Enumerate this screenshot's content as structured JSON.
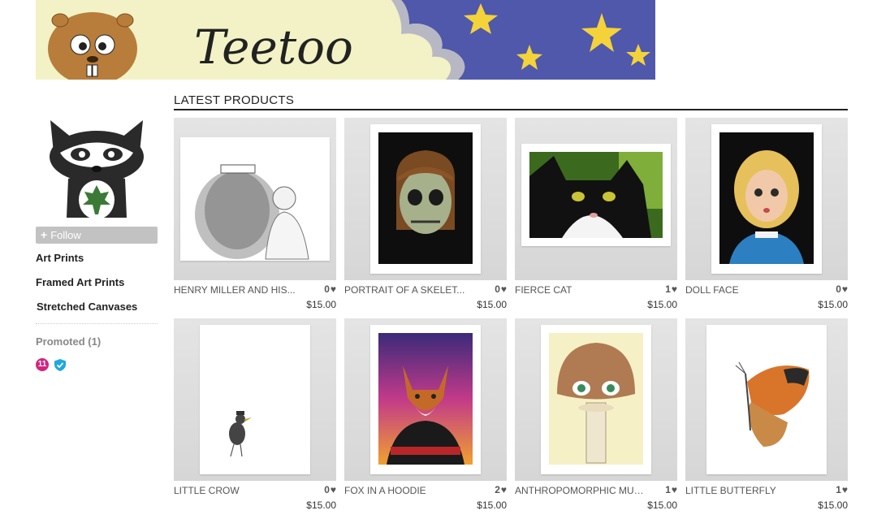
{
  "banner": {
    "logo_text": "Teetoo"
  },
  "sidebar": {
    "follow_label": "Follow",
    "links": [
      "Art Prints",
      "Framed Art Prints",
      "Stretched Canvases"
    ],
    "promoted_label": "Promoted (1)",
    "promo_count": "11"
  },
  "main": {
    "section_title": "LATEST PRODUCTS",
    "products": [
      {
        "title": "HENRY MILLER AND HIS...",
        "likes": "0",
        "price": "$15.00"
      },
      {
        "title": "PORTRAIT OF A SKELET...",
        "likes": "0",
        "price": "$15.00"
      },
      {
        "title": "FIERCE CAT",
        "likes": "1",
        "price": "$15.00"
      },
      {
        "title": "DOLL FACE",
        "likes": "0",
        "price": "$15.00"
      },
      {
        "title": "LITTLE CROW",
        "likes": "0",
        "price": "$15.00"
      },
      {
        "title": "FOX IN A HOODIE",
        "likes": "2",
        "price": "$15.00"
      },
      {
        "title": "ANTHROPOMORPHIC MUSH...",
        "likes": "1",
        "price": "$15.00"
      },
      {
        "title": "LITTLE BUTTERFLY",
        "likes": "1",
        "price": "$15.00"
      }
    ]
  },
  "icons": {
    "heart": "heart-icon",
    "plus": "plus-icon",
    "verified": "shield-check-icon"
  },
  "colors": {
    "promo_badge": "#d6237e",
    "verified": "#1fa8e0",
    "follow_bg": "#c2c2c2"
  }
}
